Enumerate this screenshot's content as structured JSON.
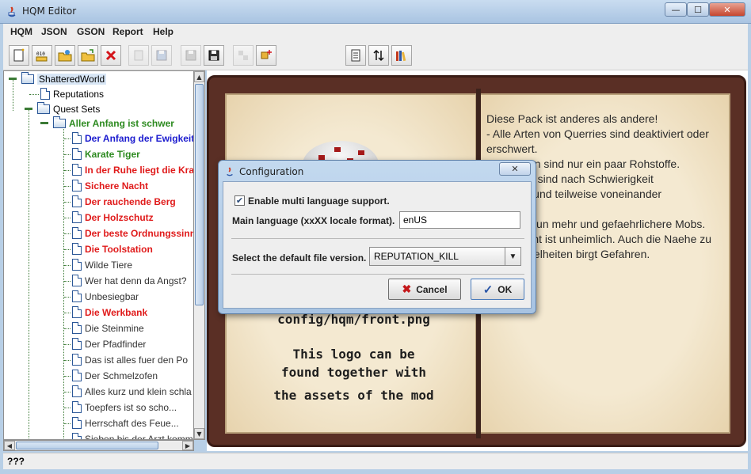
{
  "window": {
    "title": "HQM Editor",
    "controls": {
      "minimize": "—",
      "maximize": "☐",
      "close": "✕"
    }
  },
  "menu": [
    "HQM",
    "JSON",
    "GSON",
    "Report",
    "Help"
  ],
  "toolbar": {
    "buttons": [
      "new-file-icon",
      "binary-file-icon",
      "open-folder-icon",
      "open-file-icon",
      "delete-icon",
      "blank-icon",
      "save-icon",
      "save-disabled-icon",
      "save-as-icon",
      "puzzle-icon",
      "puzzle-add-icon",
      "document-icon",
      "sort-icon",
      "books-icon"
    ]
  },
  "tree": {
    "root": "ShatteredWorld",
    "reputations": "Reputations",
    "quest_sets": "Quest Sets",
    "set_name": "Aller Anfang ist schwer",
    "quests": [
      {
        "label": "Der Anfang der Ewigkeit",
        "color": "#1c1ccf"
      },
      {
        "label": "Karate Tiger",
        "color": "#2c8a1f"
      },
      {
        "label": "In der Ruhe liegt die Kraft",
        "color": "#e01b1b"
      },
      {
        "label": "Sichere Nacht",
        "color": "#e01b1b"
      },
      {
        "label": "Der rauchende Berg",
        "color": "#e01b1b"
      },
      {
        "label": "Der Holzschutz",
        "color": "#e01b1b"
      },
      {
        "label": "Der beste Ordnungssinn",
        "color": "#e01b1b"
      },
      {
        "label": "Die Toolstation",
        "color": "#e01b1b"
      },
      {
        "label": "Wilde Tiere",
        "color": "#333333"
      },
      {
        "label": "Wer hat denn da Angst?",
        "color": "#333333"
      },
      {
        "label": "Unbesiegbar",
        "color": "#333333"
      },
      {
        "label": "Die Werkbank",
        "color": "#e01b1b"
      },
      {
        "label": "Die Steinmine",
        "color": "#333333"
      },
      {
        "label": "Der Pfadfinder",
        "color": "#333333"
      },
      {
        "label": "Das ist alles fuer den Po",
        "color": "#333333"
      },
      {
        "label": "Der Schmelzofen",
        "color": "#333333"
      },
      {
        "label": "Alles kurz und klein schla",
        "color": "#333333"
      },
      {
        "label": "Toepfers ist so scho...",
        "color": "#333333"
      },
      {
        "label": "Herrschaft des Feue...",
        "color": "#333333"
      },
      {
        "label": "Sieben bis der Arzt komm",
        "color": "#333333"
      }
    ]
  },
  "book": {
    "right_page_lines": [
      "Diese Pack ist anderes als andere!",
      "- Alle Arten von Querries sind deaktiviert oder",
      "erschwert.",
      "- Im Boden sind nur ein paar Rohstoffe.",
      "- Rezepte sind nach Schwierigkeit",
      "geordnet und teilweise voneinander",
      "abhängig.",
      "- Es gibt nun mehr und gefaehrlichere Mobs.",
      "- Die Nacht ist unheimlich. Auch die Naehe zu",
      "den Dunkelheiten birgt Gefahren."
    ],
    "logo_path": "config/hqm/front.png",
    "logo_lines": [
      "This logo can be",
      "found together with",
      "the assets of the mod"
    ]
  },
  "dialog": {
    "title": "Configuration",
    "close": "✕",
    "multi_language_label": "Enable multi language support.",
    "multi_language_checked": true,
    "check_mark": "✔",
    "language_label": "Main language (xxXX locale format).",
    "language_value": "enUS",
    "version_label": "Select the default file version.",
    "version_value": "REPUTATION_KILL",
    "dropdown_arrow": "▼",
    "cancel": "Cancel",
    "cancel_icon": "✖",
    "ok": "OK",
    "ok_icon": "✓"
  },
  "status": "???"
}
